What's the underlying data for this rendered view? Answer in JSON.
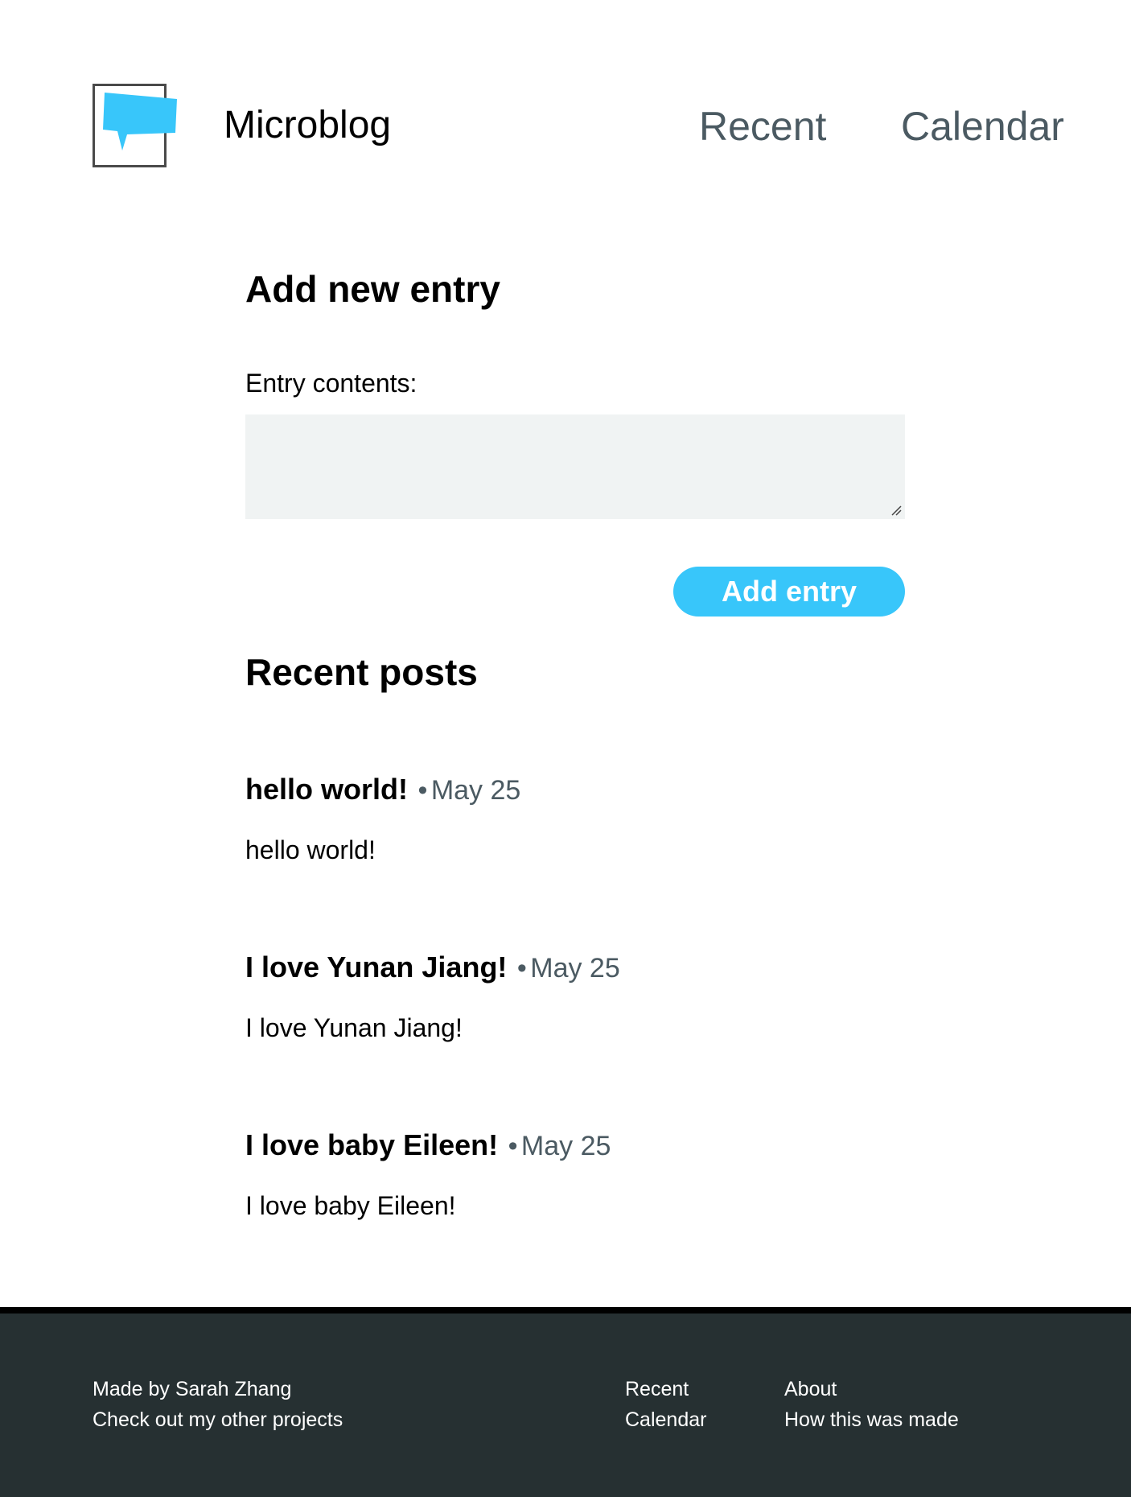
{
  "header": {
    "brand": "Microblog",
    "logo_icon": "speech-bubble-icon",
    "nav": {
      "recent": "Recent",
      "calendar": "Calendar"
    }
  },
  "form": {
    "heading": "Add new entry",
    "label": "Entry contents:",
    "textarea_value": "",
    "button_label": "Add entry"
  },
  "recent": {
    "heading": "Recent posts",
    "posts": [
      {
        "title": "hello world!",
        "separator": "•",
        "date": "May 25",
        "body": "hello world!"
      },
      {
        "title": "I love Yunan Jiang!",
        "separator": "•",
        "date": "May 25",
        "body": "I love Yunan Jiang!"
      },
      {
        "title": "I love baby Eileen!",
        "separator": "•",
        "date": "May 25",
        "body": "I love baby Eileen!"
      }
    ]
  },
  "footer": {
    "made_by": "Made by Sarah Zhang",
    "projects": "Check out my other projects",
    "recent": "Recent",
    "calendar": "Calendar",
    "about": "About",
    "how_made": "How this was made"
  },
  "colors": {
    "accent": "#38c6fa",
    "nav_text": "#4b5a62",
    "footer_bg": "#263032",
    "textarea_bg": "#f0f3f3"
  }
}
